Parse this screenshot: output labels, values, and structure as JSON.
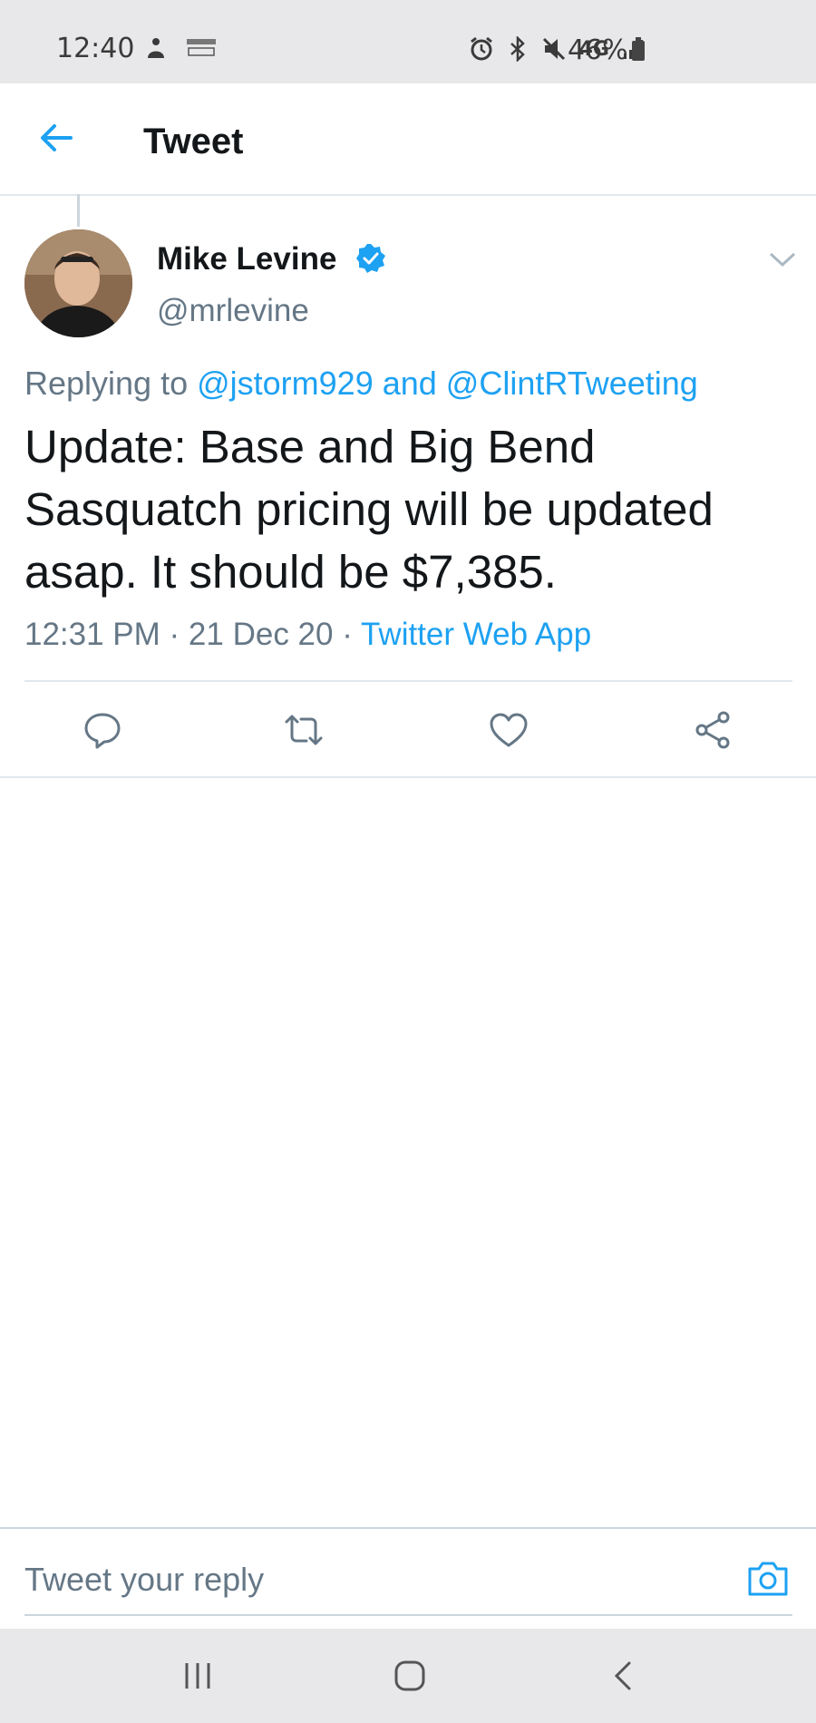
{
  "status_bar": {
    "time": "12:40",
    "network": "4G",
    "battery": "46%",
    "icons": [
      "notification-icon",
      "amazon-icon",
      "alarm-icon",
      "bluetooth-icon",
      "mute-icon",
      "signal-icon",
      "battery-icon"
    ]
  },
  "header": {
    "title": "Tweet",
    "back_icon": "arrow-left-icon"
  },
  "tweet": {
    "author_name": "Mike Levine",
    "author_handle": "@mrlevine",
    "verified": true,
    "replying_prefix": "Replying to ",
    "reply_to_1": "@jstorm929",
    "reply_and": " and ",
    "reply_to_2": "@ClintRTweeting",
    "text": "Update: Base and Big Bend Sasquatch pricing will be updated asap. It should be $7,385.",
    "time": "12:31 PM",
    "sep1": " · ",
    "date": "21 Dec 20",
    "sep2": " · ",
    "source": "Twitter Web App"
  },
  "actions": [
    {
      "name": "reply",
      "icon": "comment-icon"
    },
    {
      "name": "retweet",
      "icon": "retweet-icon"
    },
    {
      "name": "like",
      "icon": "heart-icon"
    },
    {
      "name": "share",
      "icon": "share-icon"
    }
  ],
  "composer": {
    "placeholder": "Tweet your reply",
    "value": ""
  },
  "colors": {
    "accent": "#1da1f2",
    "text": "#14171a",
    "muted": "#657786",
    "border": "#e1e8ed",
    "system_bar": "#e8e8ea"
  }
}
